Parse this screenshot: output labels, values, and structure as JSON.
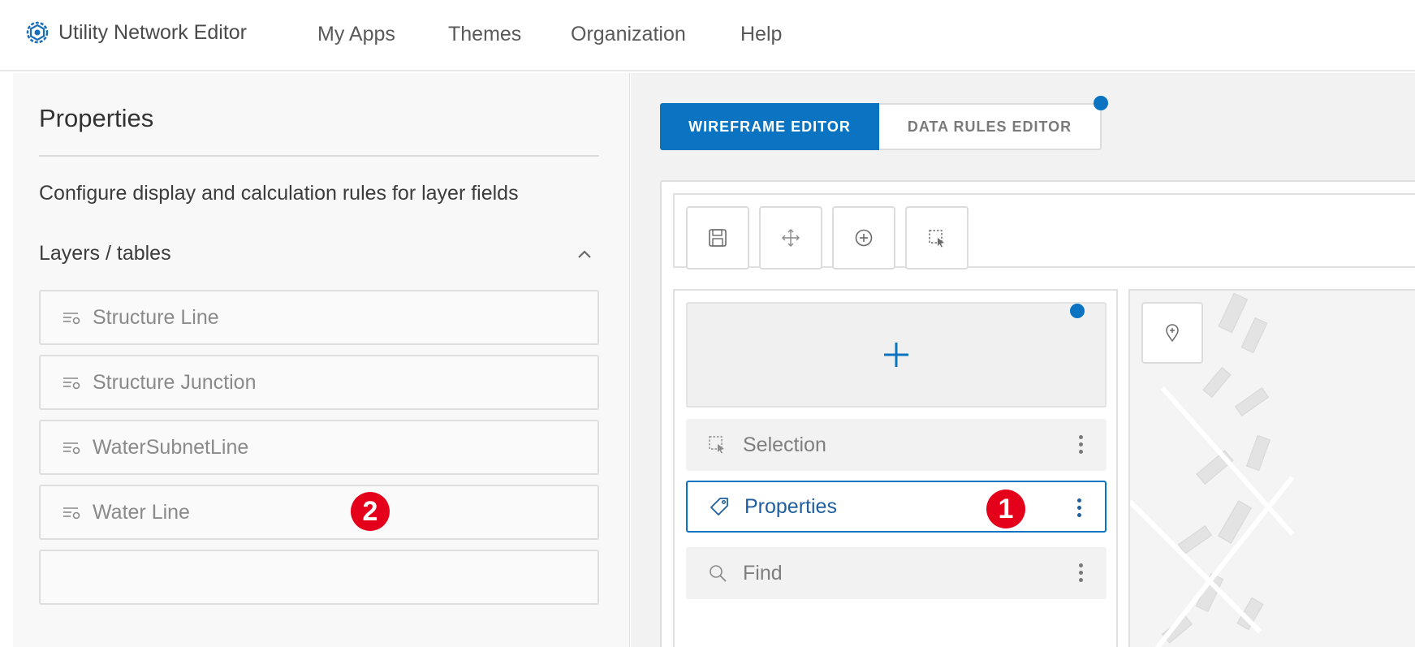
{
  "nav": {
    "brand": "Utility Network Editor",
    "links": [
      "My Apps",
      "Themes",
      "Organization",
      "Help"
    ]
  },
  "left_panel": {
    "title": "Properties",
    "description": "Configure display and calculation rules for layer fields",
    "section_label": "Layers / tables",
    "layers": [
      "Structure Line",
      "Structure Junction",
      "WaterSubnetLine",
      "Water Line"
    ]
  },
  "editor": {
    "tabs": [
      "WIREFRAME EDITOR",
      "DATA RULES EDITOR"
    ],
    "active_tab": "WIREFRAME EDITOR",
    "toolbar_icons": [
      "save-icon",
      "move-icon",
      "add-circle-icon",
      "select-icon"
    ],
    "widgets": [
      {
        "label": "Selection",
        "icon": "select-icon",
        "selected": false
      },
      {
        "label": "Properties",
        "icon": "tag-icon",
        "selected": true
      },
      {
        "label": "Find",
        "icon": "search-icon",
        "selected": false
      }
    ]
  },
  "callouts": [
    "1",
    "2"
  ],
  "colors": {
    "accent": "#0a74c2",
    "callout": "#e4001b"
  }
}
